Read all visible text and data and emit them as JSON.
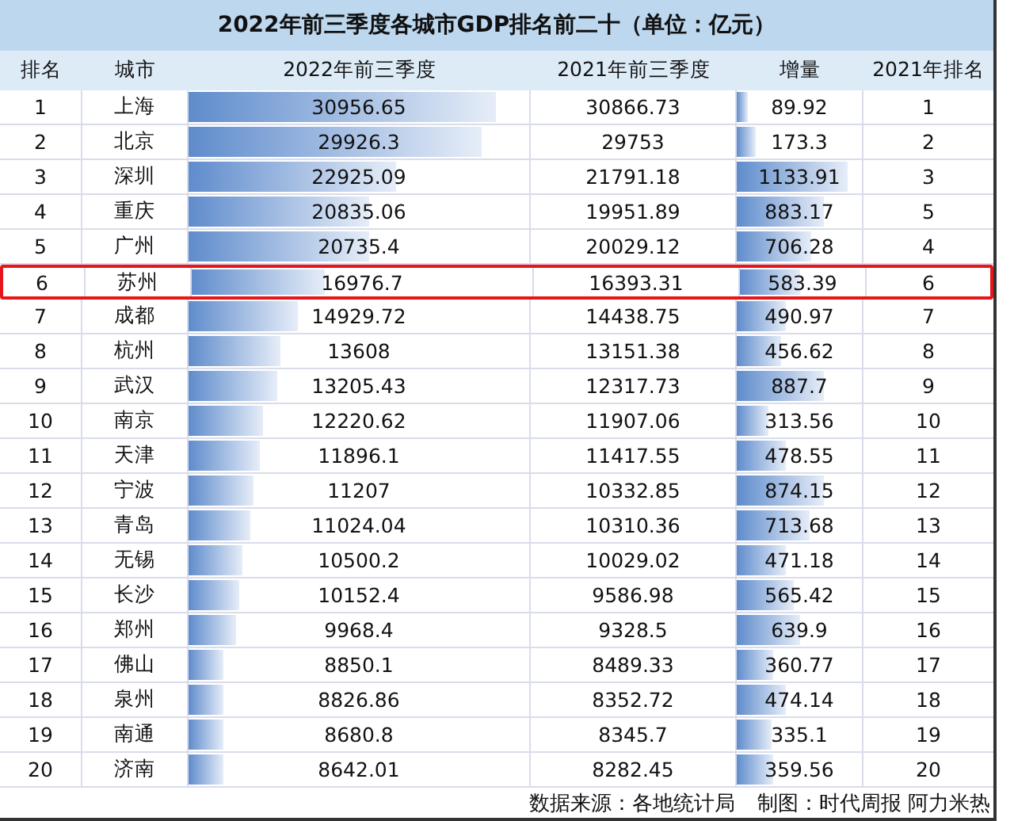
{
  "title": "2022年前三季度各城市GDP排名前二十（单位：亿元）",
  "columns": [
    "排名",
    "城市",
    "2022年前三季度",
    "2021年前三季度",
    "增量",
    "2021年排名"
  ],
  "rows": [
    {
      "rank": "1",
      "city": "上海",
      "gdp_2022": {
        "value": "30956.65",
        "level": 0.9
      },
      "gdp_2021": "30866.73",
      "increase": {
        "value": "89.92",
        "level": 0.09
      },
      "rank_2021": "1",
      "highlighted": false
    },
    {
      "rank": "2",
      "city": "北京",
      "gdp_2022": {
        "value": "29926.3",
        "level": 0.86
      },
      "gdp_2021": "29753",
      "increase": {
        "value": "173.3",
        "level": 0.15
      },
      "rank_2021": "2",
      "highlighted": false
    },
    {
      "rank": "3",
      "city": "深圳",
      "gdp_2022": {
        "value": "22925.09",
        "level": 0.61
      },
      "gdp_2021": "21791.18",
      "increase": {
        "value": "1133.91",
        "level": 0.89
      },
      "rank_2021": "3",
      "highlighted": false
    },
    {
      "rank": "4",
      "city": "重庆",
      "gdp_2022": {
        "value": "20835.06",
        "level": 0.53
      },
      "gdp_2021": "19951.89",
      "increase": {
        "value": "883.17",
        "level": 0.7
      },
      "rank_2021": "5",
      "highlighted": false
    },
    {
      "rank": "5",
      "city": "广州",
      "gdp_2022": {
        "value": "20735.4",
        "level": 0.53
      },
      "gdp_2021": "20029.12",
      "increase": {
        "value": "706.28",
        "level": 0.59
      },
      "rank_2021": "4",
      "highlighted": false
    },
    {
      "rank": "6",
      "city": "苏州",
      "gdp_2022": {
        "value": "16976.7",
        "level": 0.39
      },
      "gdp_2021": "16393.31",
      "increase": {
        "value": "583.39",
        "level": 0.48
      },
      "rank_2021": "6",
      "highlighted": true
    },
    {
      "rank": "7",
      "city": "成都",
      "gdp_2022": {
        "value": "14929.72",
        "level": 0.32
      },
      "gdp_2021": "14438.75",
      "increase": {
        "value": "490.97",
        "level": 0.39
      },
      "rank_2021": "7",
      "highlighted": false
    },
    {
      "rank": "8",
      "city": "杭州",
      "gdp_2022": {
        "value": "13608",
        "level": 0.27
      },
      "gdp_2021": "13151.38",
      "increase": {
        "value": "456.62",
        "level": 0.35
      },
      "rank_2021": "8",
      "highlighted": false
    },
    {
      "rank": "9",
      "city": "武汉",
      "gdp_2022": {
        "value": "13205.43",
        "level": 0.26
      },
      "gdp_2021": "12317.73",
      "increase": {
        "value": "887.7",
        "level": 0.7
      },
      "rank_2021": "9",
      "highlighted": false
    },
    {
      "rank": "10",
      "city": "南京",
      "gdp_2022": {
        "value": "12220.62",
        "level": 0.22
      },
      "gdp_2021": "11907.06",
      "increase": {
        "value": "313.56",
        "level": 0.25
      },
      "rank_2021": "10",
      "highlighted": false
    },
    {
      "rank": "11",
      "city": "天津",
      "gdp_2022": {
        "value": "11896.1",
        "level": 0.21
      },
      "gdp_2021": "11417.55",
      "increase": {
        "value": "478.55",
        "level": 0.39
      },
      "rank_2021": "11",
      "highlighted": false
    },
    {
      "rank": "12",
      "city": "宁波",
      "gdp_2022": {
        "value": "11207",
        "level": 0.19
      },
      "gdp_2021": "10332.85",
      "increase": {
        "value": "874.15",
        "level": 0.69
      },
      "rank_2021": "12",
      "highlighted": false
    },
    {
      "rank": "13",
      "city": "青岛",
      "gdp_2022": {
        "value": "11024.04",
        "level": 0.18
      },
      "gdp_2021": "10310.36",
      "increase": {
        "value": "713.68",
        "level": 0.58
      },
      "rank_2021": "13",
      "highlighted": false
    },
    {
      "rank": "14",
      "city": "无锡",
      "gdp_2022": {
        "value": "10500.2",
        "level": 0.16
      },
      "gdp_2021": "10029.02",
      "increase": {
        "value": "471.18",
        "level": 0.39
      },
      "rank_2021": "14",
      "highlighted": false
    },
    {
      "rank": "15",
      "city": "长沙",
      "gdp_2022": {
        "value": "10152.4",
        "level": 0.15
      },
      "gdp_2021": "9586.98",
      "increase": {
        "value": "565.42",
        "level": 0.46
      },
      "rank_2021": "15",
      "highlighted": false
    },
    {
      "rank": "16",
      "city": "郑州",
      "gdp_2022": {
        "value": "9968.4",
        "level": 0.14
      },
      "gdp_2021": "9328.5",
      "increase": {
        "value": "639.9",
        "level": 0.51
      },
      "rank_2021": "16",
      "highlighted": false
    },
    {
      "rank": "17",
      "city": "佛山",
      "gdp_2022": {
        "value": "8850.1",
        "level": 0.1
      },
      "gdp_2021": "8489.33",
      "increase": {
        "value": "360.77",
        "level": 0.29
      },
      "rank_2021": "17",
      "highlighted": false
    },
    {
      "rank": "18",
      "city": "泉州",
      "gdp_2022": {
        "value": "8826.86",
        "level": 0.1
      },
      "gdp_2021": "8352.72",
      "increase": {
        "value": "474.14",
        "level": 0.39
      },
      "rank_2021": "18",
      "highlighted": false
    },
    {
      "rank": "19",
      "city": "南通",
      "gdp_2022": {
        "value": "8680.8",
        "level": 0.1
      },
      "gdp_2021": "8345.7",
      "increase": {
        "value": "335.1",
        "level": 0.28
      },
      "rank_2021": "19",
      "highlighted": false
    },
    {
      "rank": "20",
      "city": "济南",
      "gdp_2022": {
        "value": "8642.01",
        "level": 0.1
      },
      "gdp_2021": "8282.45",
      "increase": {
        "value": "359.56",
        "level": 0.29
      },
      "rank_2021": "20",
      "highlighted": false
    }
  ],
  "footer": {
    "source": "数据来源：各地统计局",
    "credit": "制图：时代周报 阿力米热"
  }
}
